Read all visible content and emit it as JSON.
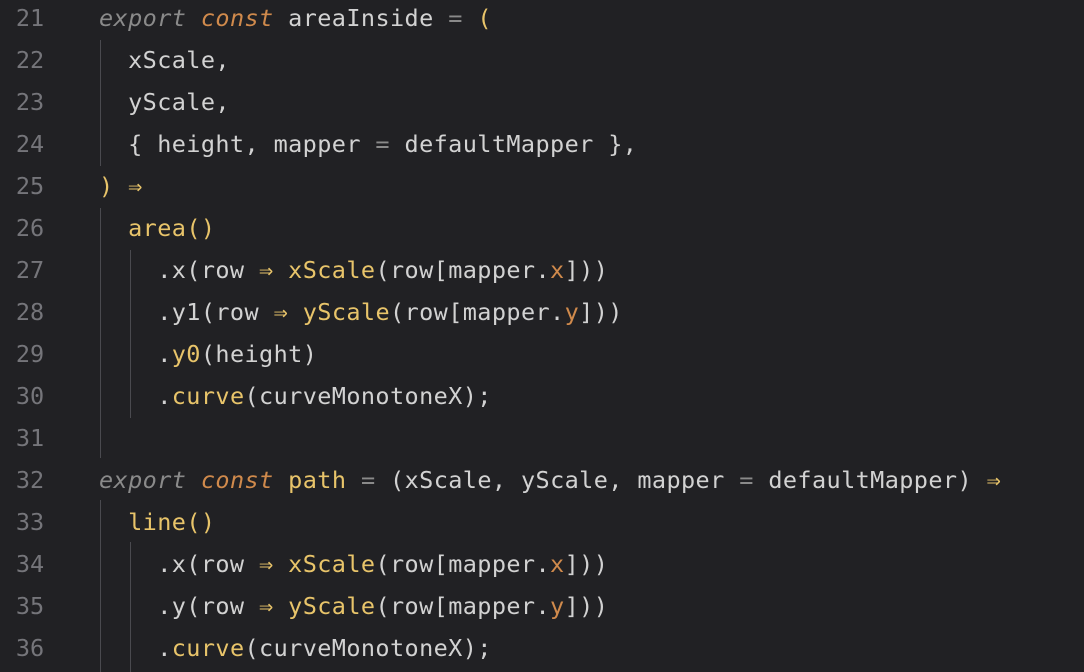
{
  "editor": {
    "theme": {
      "background": "#212124",
      "gutter": "#75757a",
      "text": "#d2d2d2",
      "keyword": "#8a8a8a",
      "const": "#d08a4c",
      "function": "#e8c46a",
      "property": "#d08a4c"
    },
    "lines": [
      {
        "num": "21",
        "tokens": [
          {
            "t": "export",
            "c": "kw"
          },
          {
            "t": " ",
            "c": "plain"
          },
          {
            "t": "const",
            "c": "const"
          },
          {
            "t": " areaInside ",
            "c": "plain"
          },
          {
            "t": "=",
            "c": "op"
          },
          {
            "t": " ",
            "c": "plain"
          },
          {
            "t": "(",
            "c": "paren"
          }
        ]
      },
      {
        "num": "22",
        "tokens": [
          {
            "t": "  xScale,",
            "c": "plain"
          }
        ]
      },
      {
        "num": "23",
        "tokens": [
          {
            "t": "  yScale,",
            "c": "plain"
          }
        ]
      },
      {
        "num": "24",
        "tokens": [
          {
            "t": "  { height, mapper ",
            "c": "plain"
          },
          {
            "t": "=",
            "c": "op"
          },
          {
            "t": " defaultMapper },",
            "c": "plain"
          }
        ]
      },
      {
        "num": "25",
        "tokens": [
          {
            "t": ")",
            "c": "paren"
          },
          {
            "t": " ",
            "c": "plain"
          },
          {
            "t": "⇒",
            "c": "arrow"
          }
        ]
      },
      {
        "num": "26",
        "tokens": [
          {
            "t": "  ",
            "c": "plain"
          },
          {
            "t": "area",
            "c": "fn"
          },
          {
            "t": "()",
            "c": "paren"
          }
        ]
      },
      {
        "num": "27",
        "tokens": [
          {
            "t": "    .x(row ",
            "c": "plain"
          },
          {
            "t": "⇒",
            "c": "arrow"
          },
          {
            "t": " ",
            "c": "plain"
          },
          {
            "t": "xScale",
            "c": "fn"
          },
          {
            "t": "(row[mapper.",
            "c": "plain"
          },
          {
            "t": "x",
            "c": "prop"
          },
          {
            "t": "]))",
            "c": "plain"
          }
        ]
      },
      {
        "num": "28",
        "tokens": [
          {
            "t": "    .y1(row ",
            "c": "plain"
          },
          {
            "t": "⇒",
            "c": "arrow"
          },
          {
            "t": " ",
            "c": "plain"
          },
          {
            "t": "yScale",
            "c": "fn"
          },
          {
            "t": "(row[mapper.",
            "c": "plain"
          },
          {
            "t": "y",
            "c": "prop"
          },
          {
            "t": "]))",
            "c": "plain"
          }
        ]
      },
      {
        "num": "29",
        "tokens": [
          {
            "t": "    .",
            "c": "plain"
          },
          {
            "t": "y0",
            "c": "fn"
          },
          {
            "t": "(height)",
            "c": "plain"
          }
        ]
      },
      {
        "num": "30",
        "tokens": [
          {
            "t": "    .",
            "c": "plain"
          },
          {
            "t": "curve",
            "c": "fn"
          },
          {
            "t": "(curveMonotoneX);",
            "c": "plain"
          }
        ]
      },
      {
        "num": "31",
        "tokens": []
      },
      {
        "num": "32",
        "tokens": [
          {
            "t": "export",
            "c": "kw"
          },
          {
            "t": " ",
            "c": "plain"
          },
          {
            "t": "const",
            "c": "const"
          },
          {
            "t": " ",
            "c": "plain"
          },
          {
            "t": "path",
            "c": "fn"
          },
          {
            "t": " ",
            "c": "plain"
          },
          {
            "t": "=",
            "c": "op"
          },
          {
            "t": " (xScale, yScale, mapper ",
            "c": "plain"
          },
          {
            "t": "=",
            "c": "op"
          },
          {
            "t": " defaultMapper) ",
            "c": "plain"
          },
          {
            "t": "⇒",
            "c": "arrow"
          }
        ]
      },
      {
        "num": "33",
        "tokens": [
          {
            "t": "  ",
            "c": "plain"
          },
          {
            "t": "line",
            "c": "fn"
          },
          {
            "t": "()",
            "c": "paren"
          }
        ]
      },
      {
        "num": "34",
        "tokens": [
          {
            "t": "    .x(row ",
            "c": "plain"
          },
          {
            "t": "⇒",
            "c": "arrow"
          },
          {
            "t": " ",
            "c": "plain"
          },
          {
            "t": "xScale",
            "c": "fn"
          },
          {
            "t": "(row[mapper.",
            "c": "plain"
          },
          {
            "t": "x",
            "c": "prop"
          },
          {
            "t": "]))",
            "c": "plain"
          }
        ]
      },
      {
        "num": "35",
        "tokens": [
          {
            "t": "    .y(row ",
            "c": "plain"
          },
          {
            "t": "⇒",
            "c": "arrow"
          },
          {
            "t": " ",
            "c": "plain"
          },
          {
            "t": "yScale",
            "c": "fn"
          },
          {
            "t": "(row[mapper.",
            "c": "plain"
          },
          {
            "t": "y",
            "c": "prop"
          },
          {
            "t": "]))",
            "c": "plain"
          }
        ]
      },
      {
        "num": "36",
        "tokens": [
          {
            "t": "    .",
            "c": "plain"
          },
          {
            "t": "curve",
            "c": "fn"
          },
          {
            "t": "(curveMonotoneX);",
            "c": "plain"
          }
        ]
      }
    ]
  }
}
